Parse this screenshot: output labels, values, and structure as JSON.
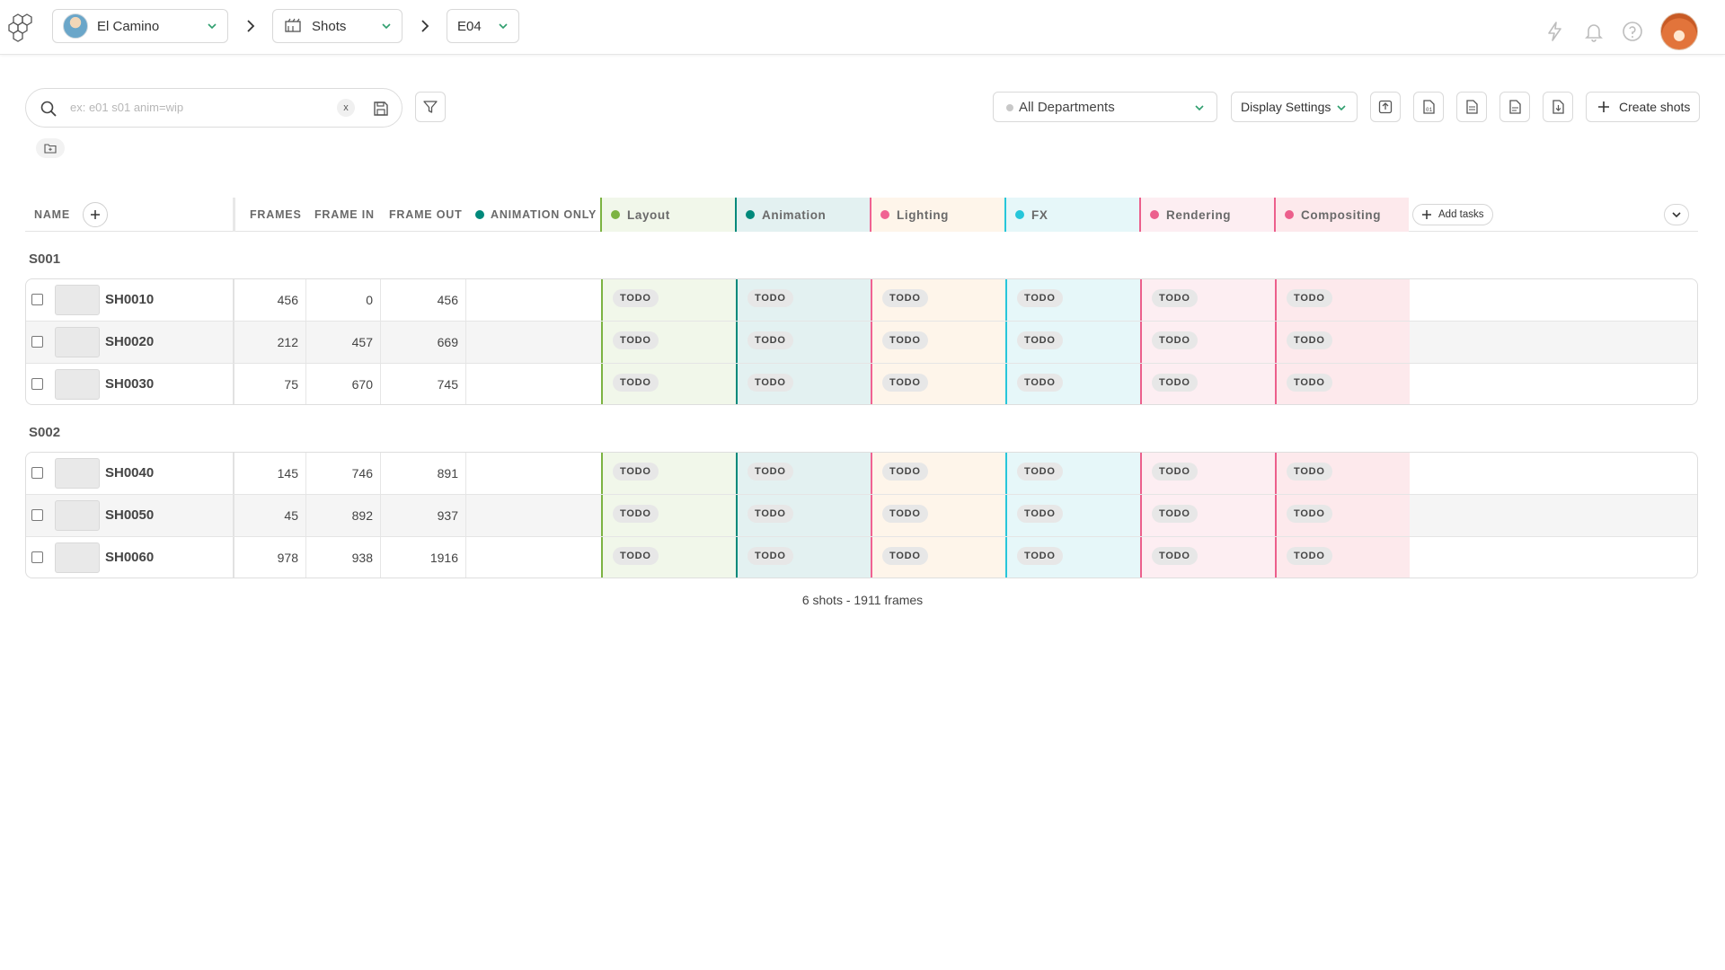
{
  "topbar": {
    "project": "El Camino",
    "section": "Shots",
    "episode": "E04"
  },
  "toolbar": {
    "search_placeholder": "ex: e01 s01 anim=wip",
    "clear_label": "x",
    "departments": "All Departments",
    "display_settings": "Display Settings",
    "create_shots": "Create shots"
  },
  "table": {
    "col_name": "NAME",
    "col_frames": "FRAMES",
    "col_frame_in": "FRAME IN",
    "col_frame_out": "FRAME OUT",
    "col_animation_only": "ANIMATION ONLY",
    "add_tasks": "Add tasks",
    "tasks": [
      {
        "label": "Layout",
        "color": "#7cb342",
        "bg": "#f1f7ea"
      },
      {
        "label": "Animation",
        "color": "#00897b",
        "bg": "#e3f1f1"
      },
      {
        "label": "Lighting",
        "color": "#f06292",
        "bg": "#fef5ea"
      },
      {
        "label": "FX",
        "color": "#26c6da",
        "bg": "#e6f7f9"
      },
      {
        "label": "Rendering",
        "color": "#ec5f8c",
        "bg": "#fdeef2"
      },
      {
        "label": "Compositing",
        "color": "#ec5f8c",
        "bg": "#fde9ec"
      }
    ],
    "status": "TODO",
    "sequences": [
      {
        "name": "S001",
        "shots": [
          {
            "name": "SH0010",
            "frames": "456",
            "in": "0",
            "out": "456"
          },
          {
            "name": "SH0020",
            "frames": "212",
            "in": "457",
            "out": "669"
          },
          {
            "name": "SH0030",
            "frames": "75",
            "in": "670",
            "out": "745"
          }
        ]
      },
      {
        "name": "S002",
        "shots": [
          {
            "name": "SH0040",
            "frames": "145",
            "in": "746",
            "out": "891"
          },
          {
            "name": "SH0050",
            "frames": "45",
            "in": "892",
            "out": "937"
          },
          {
            "name": "SH0060",
            "frames": "978",
            "in": "938",
            "out": "1916"
          }
        ]
      }
    ],
    "summary": "6 shots - 1911 frames"
  }
}
